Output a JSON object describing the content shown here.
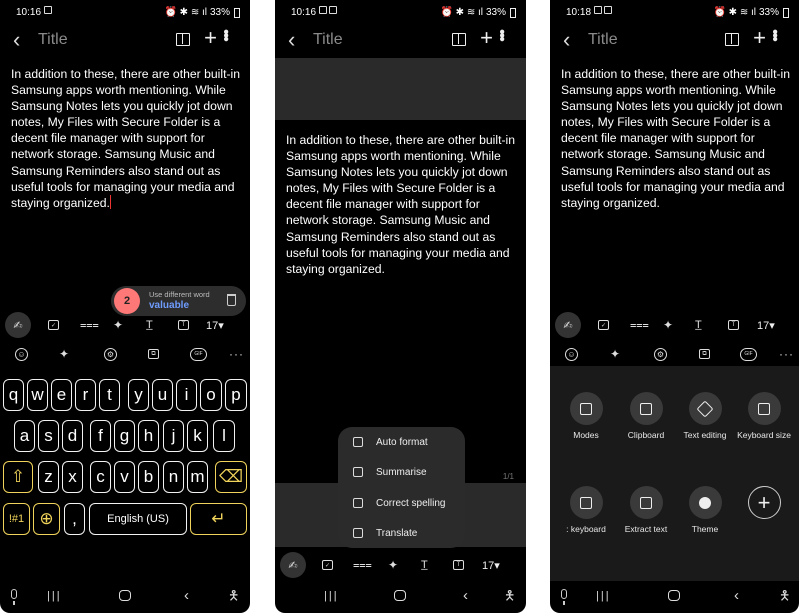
{
  "shared": {
    "title": "Title",
    "note_text": "In addition to these, there are other built-in Samsung apps worth mentioning. While Samsung Notes lets you quickly jot down notes, My Files with Secure Folder is a decent file manager with support for network storage. Samsung Music and Samsung Reminders also stand out as useful tools for managing your media and staying organized.",
    "battery": "33%",
    "font_size": "17▾"
  },
  "screen1": {
    "time": "10:16",
    "suggestion": {
      "count": "2",
      "label": "Use different word",
      "word": "valuable"
    },
    "keys": {
      "row1": [
        "q",
        "w",
        "e",
        "r",
        "t",
        "y",
        "u",
        "i",
        "o",
        "p"
      ],
      "row2": [
        "a",
        "s",
        "d",
        "f",
        "g",
        "h",
        "j",
        "k",
        "l"
      ],
      "row3": [
        "z",
        "x",
        "c",
        "v",
        "b",
        "n",
        "m"
      ],
      "sym": "!#1",
      "comma": ",",
      "space": "English (US)"
    }
  },
  "screen2": {
    "time": "10:16",
    "page": "1/1",
    "menu": [
      "Auto format",
      "Summarise",
      "Correct spelling",
      "Translate"
    ]
  },
  "screen3": {
    "time": "10:18",
    "tools": [
      {
        "label": "Modes",
        "icon": "modes-icon"
      },
      {
        "label": "Clipboard",
        "icon": "clipboard-icon"
      },
      {
        "label": "Text editing",
        "icon": "text-editing-icon"
      },
      {
        "label": "Keyboard size",
        "icon": "keyboard-size-icon"
      },
      {
        "label": ": keyboard",
        "icon": "keyboard-icon"
      },
      {
        "label": "Extract text",
        "icon": "extract-text-icon"
      },
      {
        "label": "Theme",
        "icon": "palette-icon"
      }
    ]
  },
  "colors": {
    "background": "#000000",
    "suggest_badge": "#ff7878",
    "suggest_word": "#6f9cff",
    "accent_keys": "#f0d35a"
  }
}
